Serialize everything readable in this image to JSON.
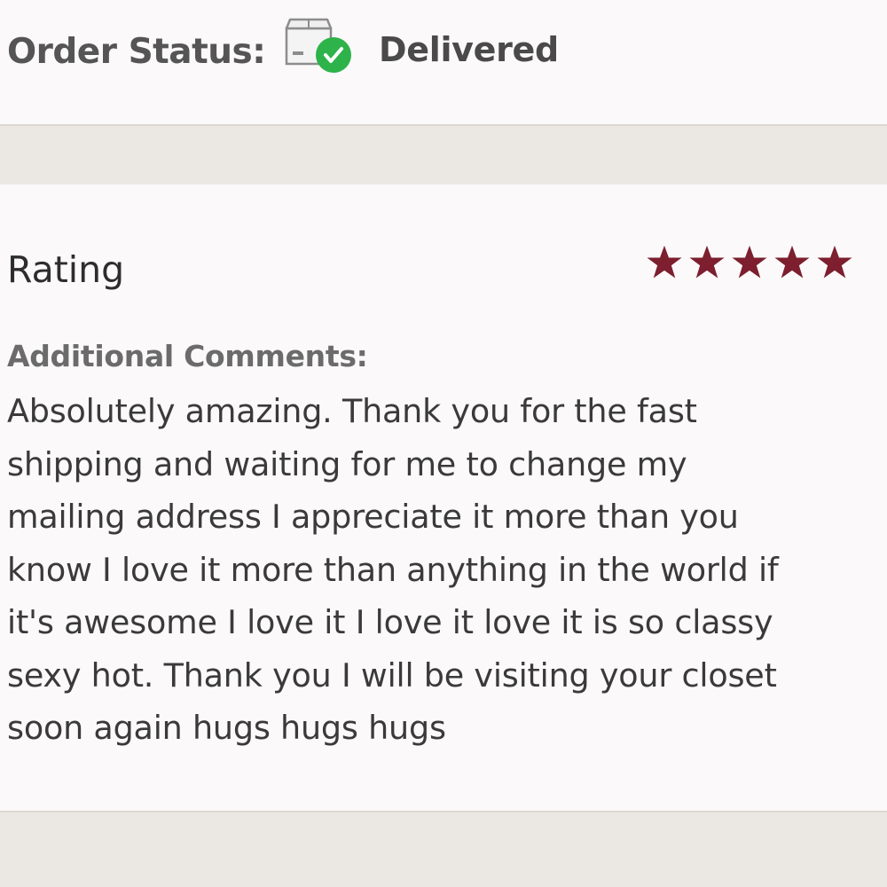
{
  "order": {
    "status_label": "Order Status:",
    "status_value": "Delivered",
    "status_icon": "package-delivered-icon",
    "check_color": "#2db34a"
  },
  "review": {
    "rating_heading": "Rating",
    "stars": 5,
    "max_stars": 5,
    "star_color": "#7d1f2e",
    "comments_label": "Additional Comments:",
    "comment_lines": [
      "Absolutely amazing. Thank you for the fast",
      "shipping and waiting for me to change my",
      "mailing address I appreciate it more than you",
      "know I love it more than anything in the world if",
      "it's awesome I love it I love it love it is so classy",
      "sexy hot. Thank you I will be visiting your closet",
      "soon again hugs hugs hugs"
    ]
  }
}
